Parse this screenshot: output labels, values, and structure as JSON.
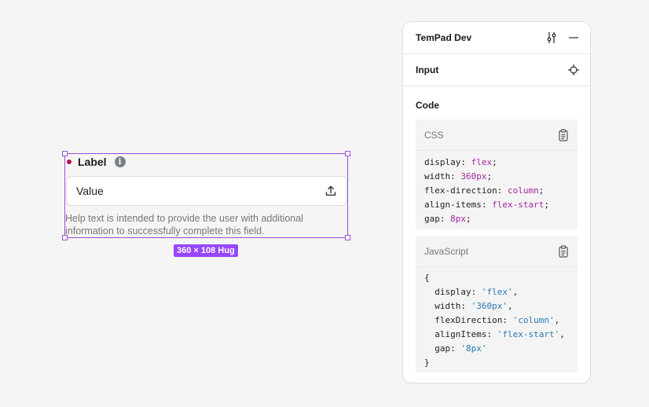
{
  "canvas": {
    "field": {
      "label": "Label",
      "info_glyph": "i",
      "value": "Value",
      "help_text": "Help text is intended to provide the user with additional information to successfully complete this field."
    },
    "size_badge": "360 × 108 Hug",
    "colors": {
      "selection": "#9b4fd6",
      "badge": "#9747ff",
      "required_dot": "#b0124e"
    }
  },
  "panel": {
    "title": "TemPad Dev",
    "node_name": "Input",
    "code_heading": "Code",
    "css": {
      "lang": "CSS",
      "lines": [
        [
          "display",
          "flex"
        ],
        [
          "width",
          "360px"
        ],
        [
          "flex-direction",
          "column"
        ],
        [
          "align-items",
          "flex-start"
        ],
        [
          "gap",
          "8px"
        ]
      ]
    },
    "javascript": {
      "lang": "JavaScript",
      "lines": [
        [
          "display",
          "'flex'"
        ],
        [
          "width",
          "'360px'"
        ],
        [
          "flexDirection",
          "'column'"
        ],
        [
          "alignItems",
          "'flex-start'"
        ],
        [
          "gap",
          "'8px'"
        ]
      ]
    },
    "icons": {
      "settings": "sliders-icon",
      "minimize": "minimize-icon",
      "target": "crosshair-icon",
      "copy": "clipboard-icon",
      "upload": "upload-icon",
      "info": "info-icon"
    },
    "colors": {
      "keyword": "#a626a4",
      "string": "#2a7ab0"
    }
  }
}
